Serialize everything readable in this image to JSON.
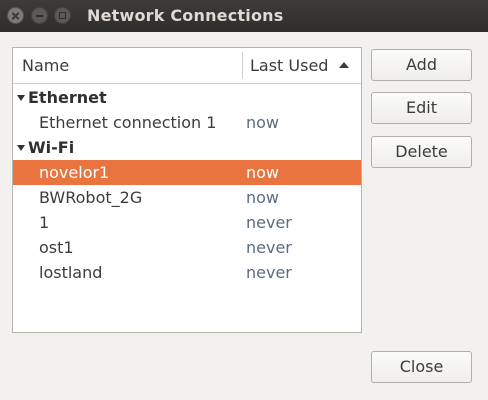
{
  "window": {
    "title": "Network Connections"
  },
  "table": {
    "columns": {
      "name": "Name",
      "last_used": "Last Used"
    },
    "groups": [
      {
        "label": "Ethernet",
        "connections": [
          {
            "name": "Ethernet connection 1",
            "last_used": "now"
          }
        ]
      },
      {
        "label": "Wi-Fi",
        "connections": [
          {
            "name": "novelor1",
            "last_used": "now",
            "selected": true
          },
          {
            "name": "BWRobot_2G",
            "last_used": "now"
          },
          {
            "name": "1",
            "last_used": "never"
          },
          {
            "name": "ost1",
            "last_used": "never"
          },
          {
            "name": "lostland",
            "last_used": "never"
          }
        ]
      }
    ]
  },
  "buttons": {
    "add": "Add",
    "edit": "Edit",
    "delete": "Delete",
    "close": "Close"
  },
  "icons": {
    "sort": "sort-ascending-icon",
    "expander": "expander-down-icon"
  },
  "colors": {
    "selection": "#e9743f",
    "titlebar": "#3d3c38",
    "last_used_text": "#5a6c83"
  }
}
